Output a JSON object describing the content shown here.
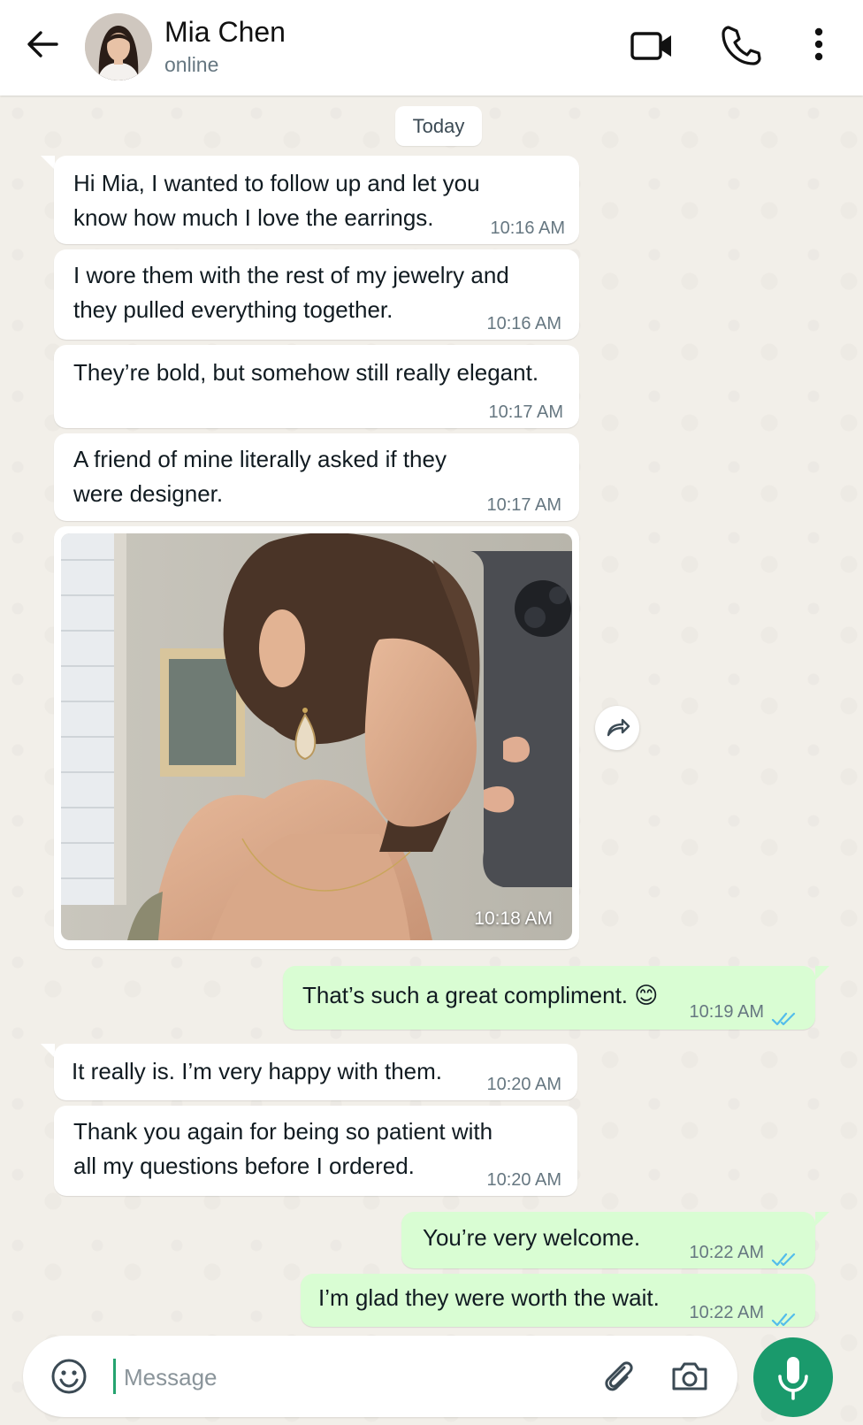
{
  "header": {
    "contact_name": "Mia Chen",
    "status": "online",
    "icons": [
      "back-arrow-icon",
      "video-call-icon",
      "voice-call-icon",
      "more-options-icon"
    ]
  },
  "date_separator": "Today",
  "messages": [
    {
      "direction": "in",
      "lines": [
        "Hi Mia, I wanted to follow up and let you",
        "know how much I love the earrings."
      ],
      "time": "10:16 AM"
    },
    {
      "direction": "in",
      "lines": [
        "I wore them with the rest of my jewelry and",
        "they pulled everything together."
      ],
      "time": "10:16 AM"
    },
    {
      "direction": "in",
      "lines": [
        "They’re bold, but somehow still really elegant."
      ],
      "time": "10:17 AM"
    },
    {
      "direction": "in",
      "lines": [
        "A friend of mine literally asked if they",
        "were designer."
      ],
      "time": "10:17 AM"
    },
    {
      "direction": "in",
      "type": "photo",
      "time": "10:18 AM"
    },
    {
      "direction": "out",
      "lines": [
        "That’s such a great compliment. 😊"
      ],
      "time": "10:19 AM",
      "status": "read"
    },
    {
      "direction": "in",
      "lines": [
        "It really is. I’m very happy with them."
      ],
      "time": "10:20 AM"
    },
    {
      "direction": "in",
      "lines": [
        "Thank you again for being so patient with",
        "all my questions before I ordered."
      ],
      "time": "10:20 AM"
    },
    {
      "direction": "out",
      "lines": [
        "You’re very welcome."
      ],
      "time": "10:22 AM",
      "status": "read"
    },
    {
      "direction": "out",
      "lines": [
        "I’m glad they were worth the wait."
      ],
      "time": "10:22 AM",
      "status": "read"
    }
  ],
  "composer": {
    "placeholder": "Message",
    "icons": [
      "emoji-icon",
      "attach-icon",
      "camera-icon",
      "microphone-icon"
    ]
  },
  "colors": {
    "outgoing_bubble": "#d9fdd3",
    "incoming_bubble": "#ffffff",
    "read_ticks": "#53bdeb",
    "mic_button": "#1a9a6c",
    "chat_background": "#f2efe9"
  }
}
